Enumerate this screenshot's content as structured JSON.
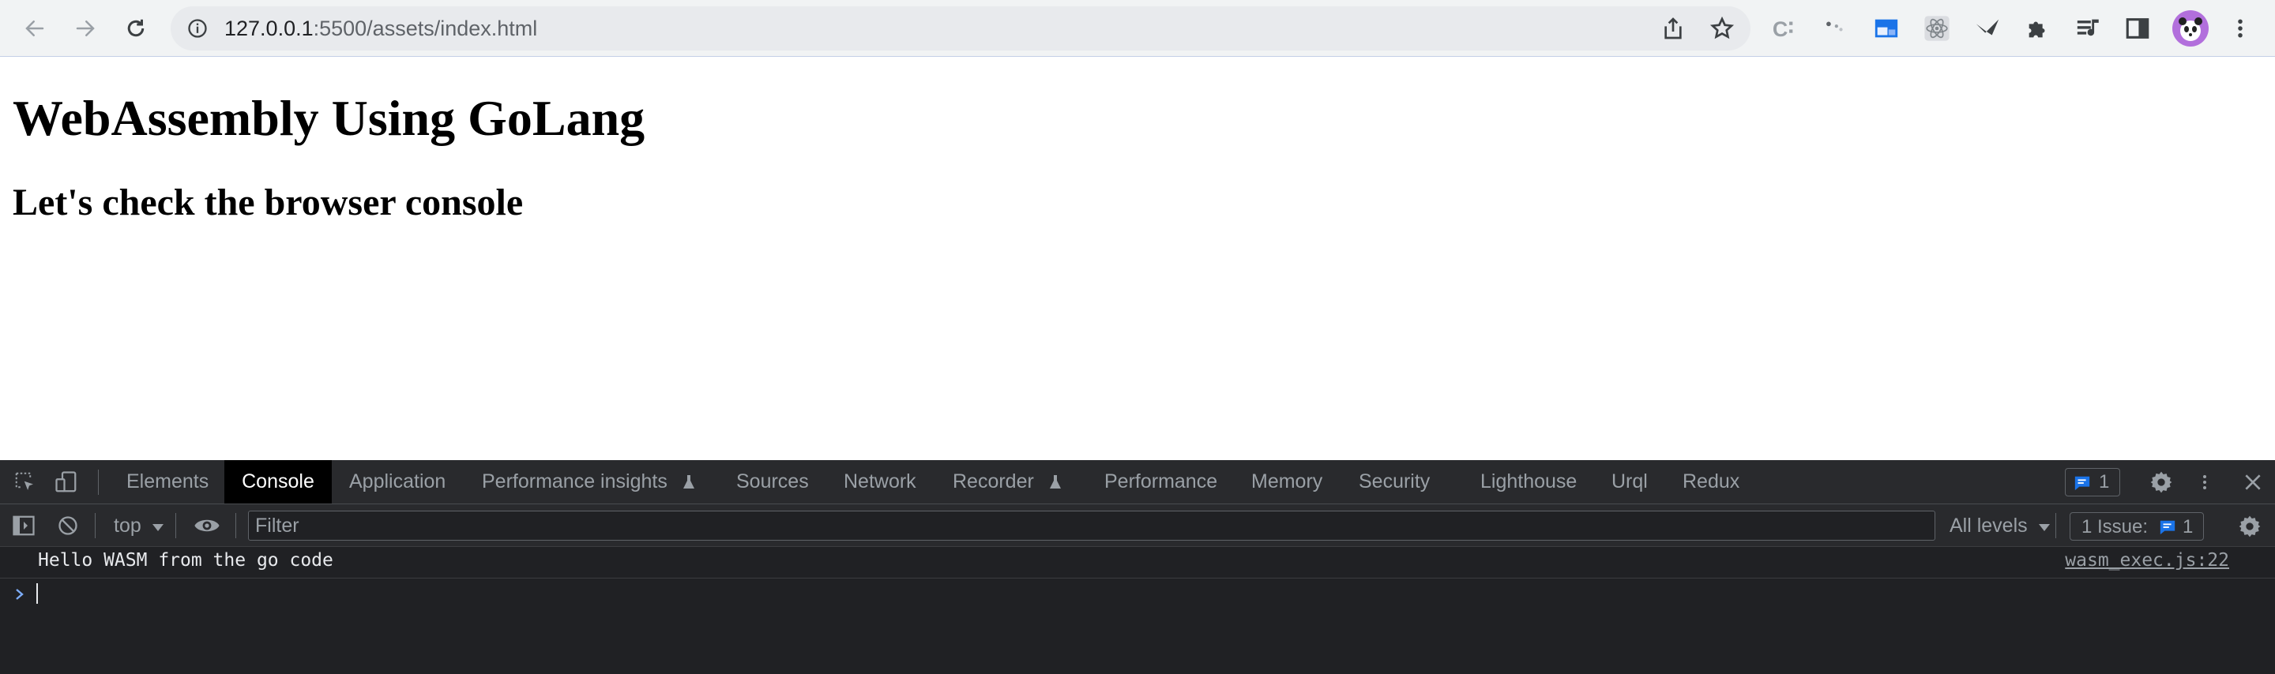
{
  "browser": {
    "url_host": "127.0.0.1",
    "url_path": ":5500/assets/index.html"
  },
  "page": {
    "title": "WebAssembly Using GoLang",
    "subtitle": "Let's check the browser console"
  },
  "devtools": {
    "tabs": [
      {
        "label": "Elements"
      },
      {
        "label": "Console",
        "active": true
      },
      {
        "label": "Application"
      },
      {
        "label": "Performance insights",
        "experimental": true
      },
      {
        "label": "Sources"
      },
      {
        "label": "Network"
      },
      {
        "label": "Recorder",
        "experimental": true
      },
      {
        "label": "Performance"
      },
      {
        "label": "Memory"
      },
      {
        "label": "Security"
      },
      {
        "label": "Lighthouse"
      },
      {
        "label": "Urql"
      },
      {
        "label": "Redux"
      }
    ],
    "messages_count": "1",
    "context": "top",
    "filter_placeholder": "Filter",
    "levels": "All levels",
    "issues_label": "1 Issue:",
    "issues_count": "1",
    "log": {
      "message": "Hello WASM from the go code",
      "source": "wasm_exec.js:22"
    }
  },
  "colors": {
    "toolbar_bg": "#f1f3f4",
    "omnibox_bg": "#e8eaed",
    "devtools_bg": "#202124",
    "devtools_tabbar_bg": "#292a2d",
    "accent_blue": "#1a73e8",
    "avatar_purple": "#b26fdc"
  }
}
